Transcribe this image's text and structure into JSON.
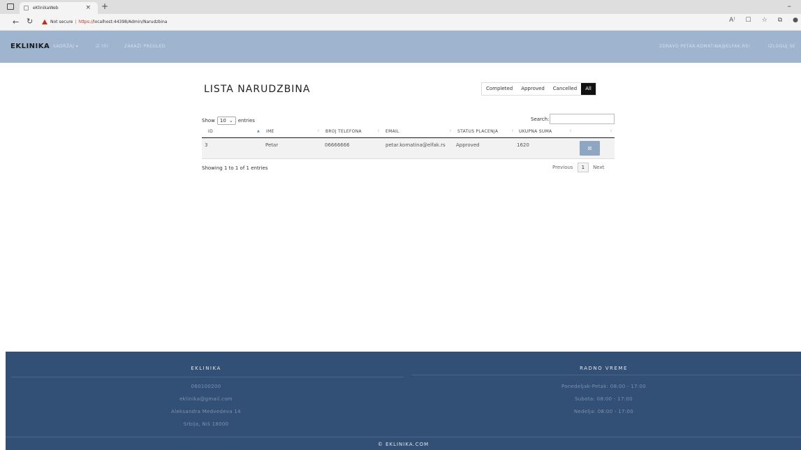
{
  "browser": {
    "tab_title": "eKlinikaWeb",
    "new_tab": "+",
    "close_tab": "×",
    "minimize": "–",
    "not_secure": "Not secure",
    "url_https": "https://",
    "url_rest": "localhost:44398/Admin/Narudzbina"
  },
  "navbar": {
    "brand": "EKLINIKA",
    "items": [
      "SADRŽAJ ▾",
      "☑ (0)",
      "ZAKAŽI PREGLED"
    ],
    "greeting": "ZDRAVO PETAR.KOMATINA@ELFAK.RS!",
    "logout": "IZLOGUJ SE"
  },
  "main": {
    "title": "LISTA NARUDZBINA",
    "filters": [
      "Completed",
      "Approved",
      "Cancelled",
      "All"
    ],
    "active_filter": "All",
    "show_label": "Show",
    "length_value": "10",
    "entries_label": "entries",
    "search_label": "Search:",
    "columns": [
      "ID",
      "IME",
      "BROJ TELEFONA",
      "EMAIL",
      "STATUS PLACENJA",
      "UKUPNA SUMA",
      ""
    ],
    "rows": [
      {
        "id": "3",
        "ime": "Petar",
        "telefon": "06666666",
        "email": "petar.komatina@elfak.rs",
        "status": "Approved",
        "suma": "1620"
      }
    ],
    "info": "Showing 1 to 1 of 1 entries",
    "pager": {
      "previous": "Previous",
      "current": "1",
      "next": "Next"
    }
  },
  "footer": {
    "left_title": "EKLINIKA",
    "left_items": [
      "060100200",
      "eklinika@gmail.com",
      "Aleksandra Medvedeva 14",
      "Srbija, Niš 18000"
    ],
    "right_title": "RADNO VREME",
    "right_items": [
      "Ponedeljak-Petak: 08:00 - 17:00",
      "Subota: 08:00 - 17:00",
      "Nedelja: 08:00 - 17:00"
    ],
    "copyright": "© EKLINIKA.COM"
  },
  "colors": {
    "navbar": "#9eb4cf",
    "footer": "#324f75",
    "edit_button": "#8fa6c2"
  }
}
